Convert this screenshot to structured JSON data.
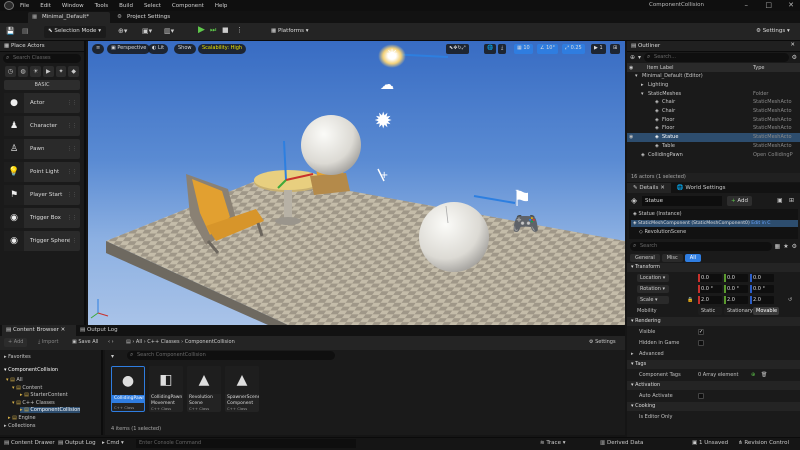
{
  "menu": {
    "items": [
      "File",
      "Edit",
      "Window",
      "Tools",
      "Build",
      "Select",
      "Component",
      "Help"
    ],
    "project": "ComponentCollision"
  },
  "tabs": {
    "level": "Minimal_Default*",
    "settings": "Project Settings"
  },
  "toolbar": {
    "selection_mode": "Selection Mode",
    "platforms": "Platforms",
    "settings": "Settings"
  },
  "place_actors": {
    "title": "Place Actors",
    "search_placeholder": "Search Classes",
    "category": "BASIC",
    "items": [
      "Actor",
      "Character",
      "Pawn",
      "Point Light",
      "Player Start",
      "Trigger Box",
      "Trigger Sphere"
    ]
  },
  "viewport": {
    "perspective": "Perspective",
    "lit": "Lit",
    "show": "Show",
    "scalability": "Scalability: High",
    "grid": "10",
    "angle": "10°",
    "scale": "0.25",
    "cams": "1"
  },
  "outliner": {
    "title": "Outliner",
    "search_placeholder": "Search...",
    "col_label": "Item Label",
    "col_type": "Type",
    "rows": [
      {
        "label": "Minimal_Default (Editor)",
        "type": "",
        "indent": 8,
        "icon": "▾"
      },
      {
        "label": "Lighting",
        "type": "",
        "indent": 14,
        "icon": "▸"
      },
      {
        "label": "StaticMeshes",
        "type": "Folder",
        "indent": 14,
        "icon": "▾"
      },
      {
        "label": "Chair",
        "type": "StaticMeshActo",
        "indent": 28,
        "icon": "◈"
      },
      {
        "label": "Chair",
        "type": "StaticMeshActo",
        "indent": 28,
        "icon": "◈"
      },
      {
        "label": "Floor",
        "type": "StaticMeshActo",
        "indent": 28,
        "icon": "◈"
      },
      {
        "label": "Floor",
        "type": "StaticMeshActo",
        "indent": 28,
        "icon": "◈"
      },
      {
        "label": "Statue",
        "type": "StaticMeshActo",
        "indent": 28,
        "icon": "◈",
        "sel": true
      },
      {
        "label": "Table",
        "type": "StaticMeshActo",
        "indent": 28,
        "icon": "◈"
      },
      {
        "label": "CollidingPawn",
        "type": "Open CollidingP",
        "indent": 14,
        "icon": "◈"
      }
    ],
    "status": "16 actors (1 selected)"
  },
  "details": {
    "title": "Details",
    "world_settings": "World Settings",
    "actor_name": "Statue",
    "add": "Add",
    "instance": "Statue (Instance)",
    "component": "StaticMeshComponent (StaticMeshComponent0)",
    "edit": "Edit in C",
    "scene": "RevolutionScene",
    "search_placeholder": "Search",
    "filters": [
      "General",
      "Misc",
      "All"
    ],
    "transform": "Transform",
    "location": "Location",
    "rotation": "Rotation",
    "scale": "Scale",
    "mobility": "Mobility",
    "loc": [
      "0.0",
      "0.0",
      "0.0"
    ],
    "rot": [
      "0.0 °",
      "0.0 °",
      "0.0 °"
    ],
    "scl": [
      "2.0",
      "2.0",
      "2.0"
    ],
    "mobility_opts": [
      "Static",
      "Stationary",
      "Movable"
    ],
    "rendering": "Rendering",
    "visible": "Visible",
    "hidden_in_game": "Hidden in Game",
    "advanced": "Advanced",
    "tags": "Tags",
    "component_tags": "Component Tags",
    "tags_count": "0 Array element",
    "activation": "Activation",
    "auto_activate": "Auto Activate",
    "cooking": "Cooking",
    "cooking_item": "Is Editor Only"
  },
  "content_browser": {
    "tab": "Content Browser",
    "output_tab": "Output Log",
    "add": "Add",
    "import": "Import",
    "save_all": "Save All",
    "crumbs": [
      "All",
      "C++ Classes",
      "ComponentCollision"
    ],
    "settings": "Settings",
    "search_placeholder": "Search ComponentCollision",
    "favorites": "Favorites",
    "root": "ComponentCollision",
    "collections": "Collections",
    "tree": [
      {
        "label": "All",
        "indent": 6,
        "icon": "▾"
      },
      {
        "label": "Content",
        "indent": 12,
        "icon": "▾"
      },
      {
        "label": "StarterContent",
        "indent": 20,
        "icon": "▸"
      },
      {
        "label": "C++ Classes",
        "indent": 12,
        "icon": "▾"
      },
      {
        "label": "ComponentCollision",
        "indent": 20,
        "icon": "▸",
        "sel": true
      },
      {
        "label": "Engine",
        "indent": 8,
        "icon": "▸"
      }
    ],
    "assets": [
      {
        "name": "CollidingPawn",
        "type": "C++ Class",
        "glyph": "●",
        "sel": true
      },
      {
        "name": "CollidingPawn Movement",
        "type": "C++ Class",
        "glyph": "◧"
      },
      {
        "name": "Revolution Scene",
        "type": "C++ Class",
        "glyph": "▲"
      },
      {
        "name": "SpawnerScene Component",
        "type": "C++ Class",
        "glyph": "▲"
      }
    ],
    "count": "4 items (1 selected)"
  },
  "statusbar": {
    "drawer": "Content Drawer",
    "output": "Output Log",
    "cmd": "Cmd",
    "cmd_placeholder": "Enter Console Command",
    "trace": "Trace",
    "derived": "Derived Data",
    "unsaved": "1 Unsaved",
    "revision": "Revision Control"
  }
}
